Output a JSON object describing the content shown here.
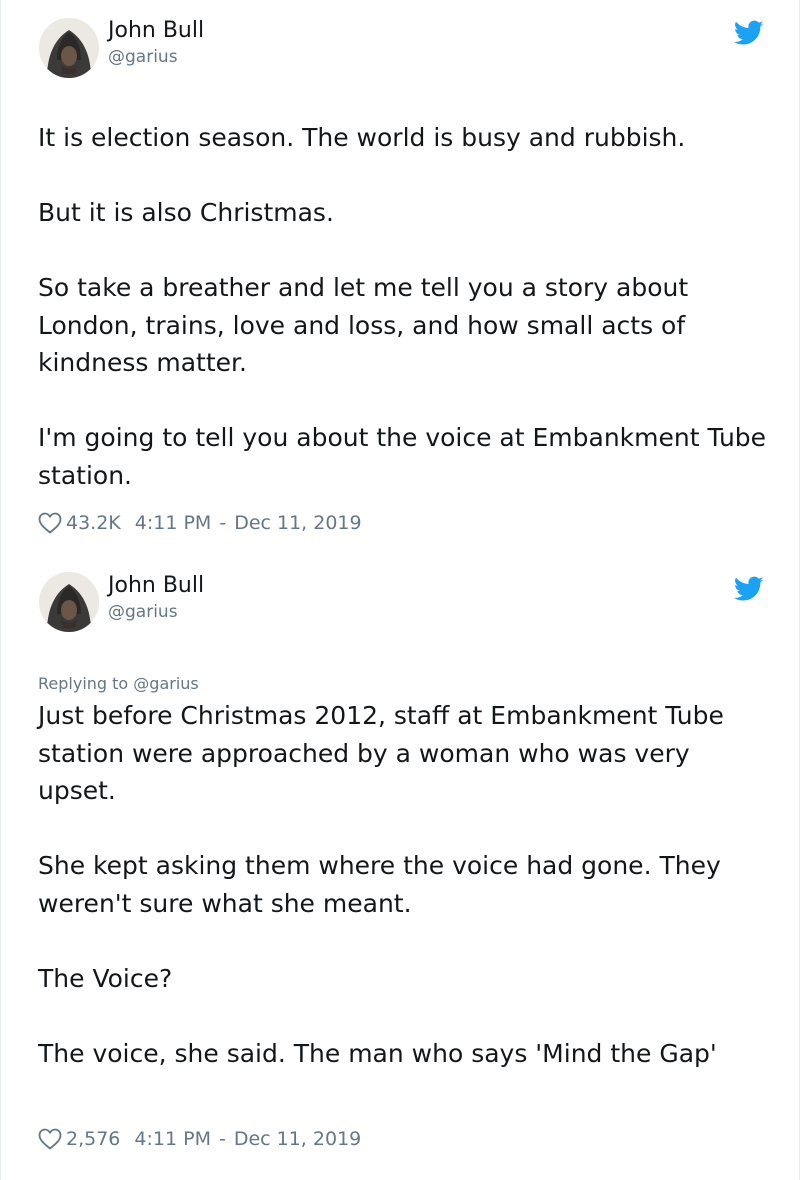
{
  "tweets": [
    {
      "author": {
        "name": "John Bull",
        "handle": "@garius",
        "avatar_icon": "hooded-figure-avatar"
      },
      "paragraphs": [
        "It is election season. The world is busy and rubbish.",
        "But it is also Christmas.",
        "So take a breather and let me tell you a story about London, trains, love and loss, and how small acts of kindness matter.",
        "I'm going to tell you about the voice at Embankment Tube station."
      ],
      "likes": "43.2K",
      "time": "4:11 PM",
      "date": "Dec 11, 2019"
    },
    {
      "author": {
        "name": "John Bull",
        "handle": "@garius",
        "avatar_icon": "hooded-figure-avatar"
      },
      "replying_label": "Replying to",
      "replying_handle": "@garius",
      "paragraphs": [
        "Just before Christmas 2012, staff at Embankment Tube station were approached by a woman who was very upset.",
        "She kept asking them where the voice had gone. They weren't sure what she meant.",
        "The Voice?",
        "The voice, she said. The man who says 'Mind the Gap'"
      ],
      "likes": "2,576",
      "time": "4:11 PM",
      "date": "Dec 11, 2019"
    }
  ],
  "meta_separator": "-",
  "icons": {
    "bird": "twitter-bird-icon",
    "heart": "heart-outline-icon"
  },
  "colors": {
    "twitter_blue": "#1da1f2",
    "text": "#14171a",
    "muted": "#657786"
  }
}
